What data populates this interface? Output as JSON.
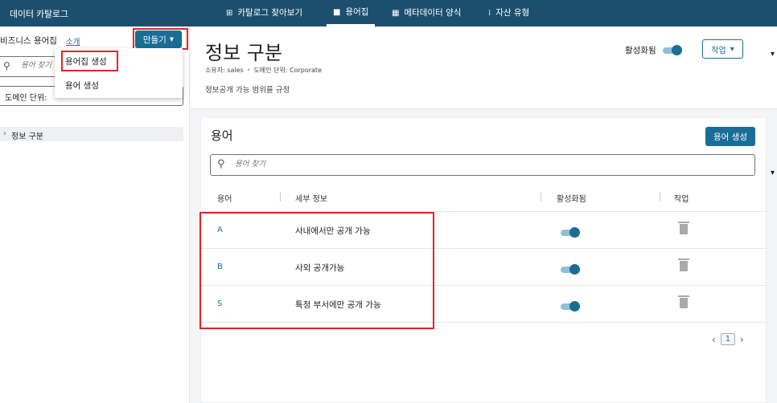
{
  "topbar": {
    "brand": "데이터 카탈로그",
    "tabs": [
      {
        "icon": "grid-icon",
        "glyph": "⊞",
        "label": "카탈로그 찾아보기"
      },
      {
        "icon": "folder-icon",
        "glyph": "■",
        "label": "용어집",
        "active": true
      },
      {
        "icon": "metadata-icon",
        "glyph": "▦",
        "label": "메타데이터 양식"
      },
      {
        "icon": "asset-type-icon",
        "glyph": "⁞",
        "label": "자산 유형"
      }
    ]
  },
  "sidebar": {
    "title": "비즈니스 용어집",
    "about_link": "소개",
    "create_label": "만들기",
    "search_placeholder": "용어 찾기",
    "domain_label": "도메인 단위:",
    "tree_item": "정보 구분"
  },
  "create_menu": {
    "items": [
      "용어집 생성",
      "용어 생성"
    ]
  },
  "header": {
    "title": "정보 구분",
    "owner": "소유자: sales",
    "domain": "도메인 단위: Corporate",
    "description": "정보공개 가능 범위를 규정",
    "active_label": "활성화됨",
    "active": true,
    "action_label": "작업"
  },
  "terms": {
    "title": "용어",
    "create_label": "용어 생성",
    "search_placeholder": "용어 찾기",
    "columns": [
      "용어",
      "세부 정보",
      "활성화됨",
      "작업"
    ],
    "rows": [
      {
        "term": "A",
        "detail": "사내에서만 공개 가능",
        "active": true
      },
      {
        "term": "B",
        "detail": "사외 공개가능",
        "active": true
      },
      {
        "term": "S",
        "detail": "특정 부서에만 공개 가능",
        "active": true
      }
    ],
    "page": "1"
  },
  "colors": {
    "topbar": "#1c4f6e",
    "primary": "#1a6d97",
    "highlight": "#e0262b"
  }
}
